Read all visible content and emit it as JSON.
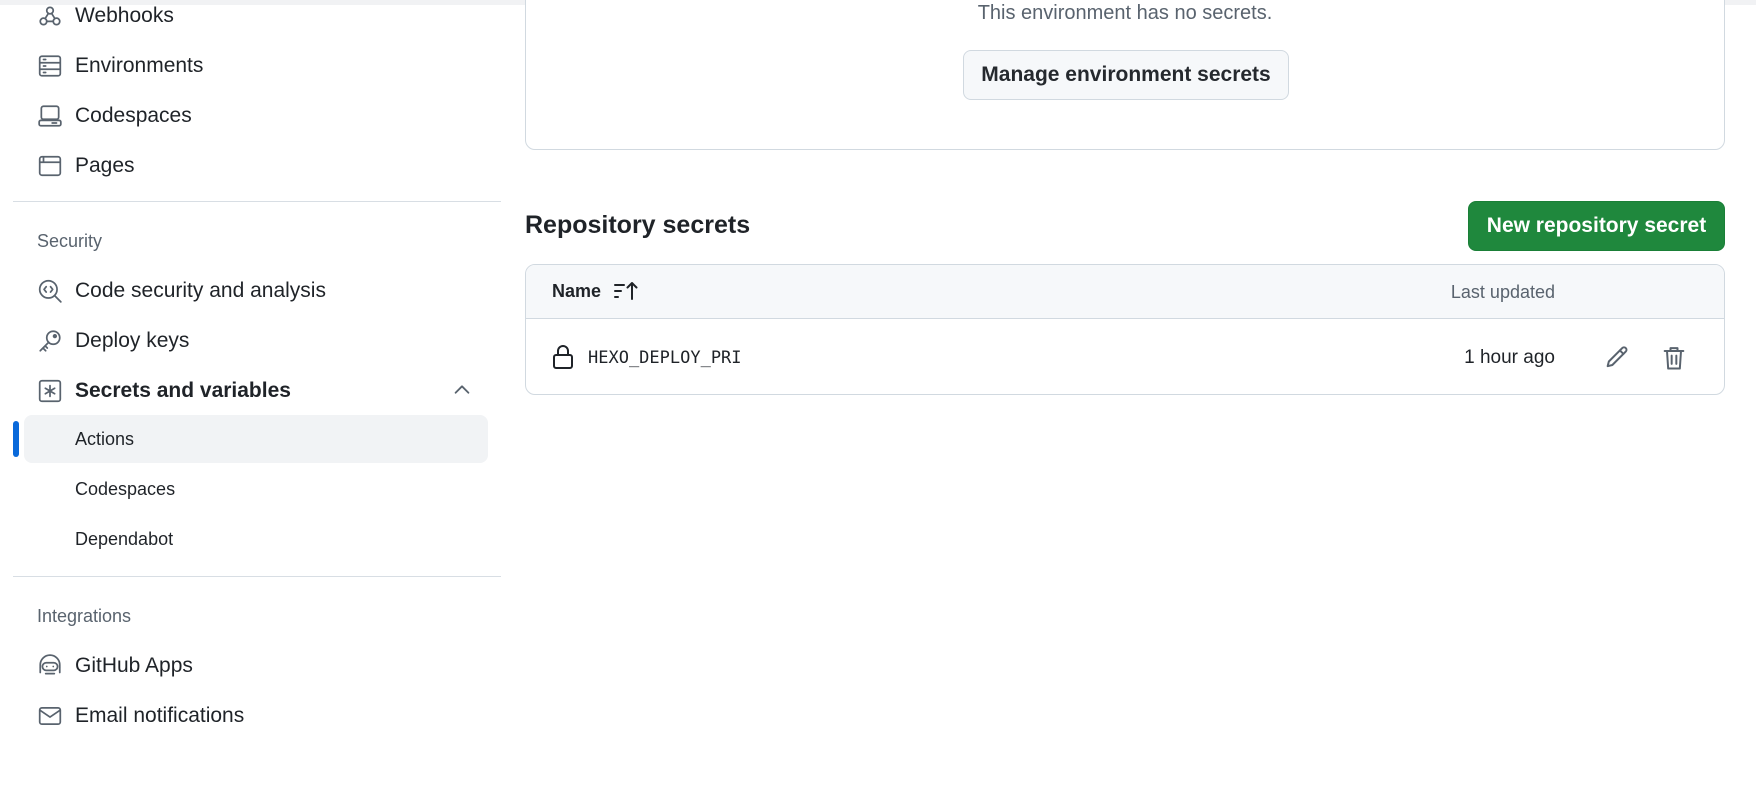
{
  "sidebar": {
    "top_items": [
      {
        "label": "Webhooks",
        "icon": "webhook-icon"
      },
      {
        "label": "Environments",
        "icon": "server-icon"
      },
      {
        "label": "Codespaces",
        "icon": "codespaces-icon"
      },
      {
        "label": "Pages",
        "icon": "browser-icon"
      }
    ],
    "security": {
      "heading": "Security",
      "items": [
        {
          "label": "Code security and analysis",
          "icon": "codescan-icon"
        },
        {
          "label": "Deploy keys",
          "icon": "key-icon"
        },
        {
          "label": "Secrets and variables",
          "icon": "key-asterisk-icon",
          "expanded": true
        }
      ],
      "sub_items": [
        {
          "label": "Actions",
          "active": true
        },
        {
          "label": "Codespaces",
          "active": false
        },
        {
          "label": "Dependabot",
          "active": false
        }
      ]
    },
    "integrations": {
      "heading": "Integrations",
      "items": [
        {
          "label": "GitHub Apps",
          "icon": "hubot-icon"
        },
        {
          "label": "Email notifications",
          "icon": "mail-icon"
        }
      ]
    }
  },
  "environment": {
    "empty_text": "This environment has no secrets.",
    "manage_button": "Manage environment secrets"
  },
  "repository_secrets": {
    "title": "Repository secrets",
    "new_button": "New repository secret",
    "columns": {
      "name": "Name",
      "last_updated": "Last updated"
    },
    "rows": [
      {
        "name": "HEXO_DEPLOY_PRI",
        "last_updated": "1 hour ago"
      }
    ]
  },
  "colors": {
    "accent": "#0969da",
    "primary_button": "#1f883d",
    "border": "#d1d9e0",
    "muted_text": "#59636e"
  }
}
